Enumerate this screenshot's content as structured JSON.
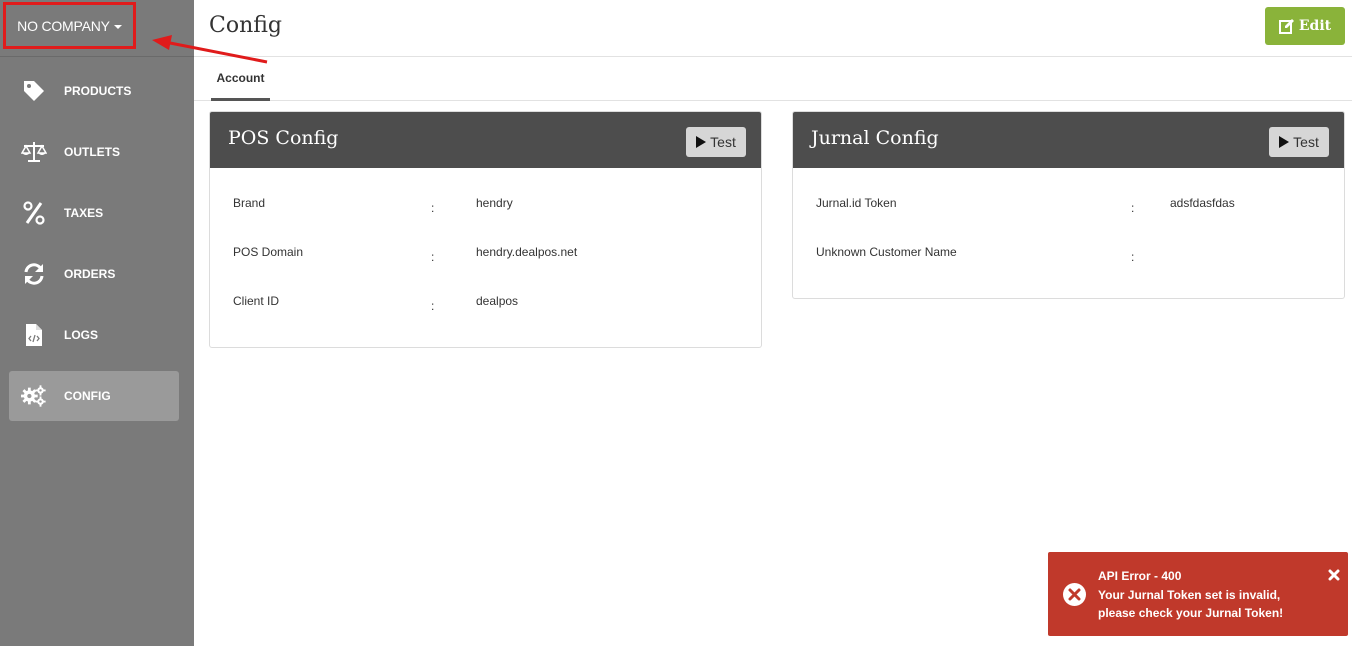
{
  "company": {
    "label": "NO COMPANY"
  },
  "sidebar": {
    "items": [
      {
        "label": "PRODUCTS",
        "icon": "tag-icon"
      },
      {
        "label": "OUTLETS",
        "icon": "scale-icon"
      },
      {
        "label": "TAXES",
        "icon": "percent-icon"
      },
      {
        "label": "ORDERS",
        "icon": "sync-icon"
      },
      {
        "label": "LOGS",
        "icon": "code-file-icon"
      },
      {
        "label": "CONFIG",
        "icon": "gears-icon",
        "active": true
      }
    ]
  },
  "header": {
    "title": "Config",
    "edit_label": "Edit"
  },
  "tabs": [
    {
      "label": "Account",
      "active": true
    }
  ],
  "pos_config": {
    "title": "POS Config",
    "test_label": "Test",
    "fields": [
      {
        "label": "Brand",
        "value": "hendry"
      },
      {
        "label": "POS Domain",
        "value": "hendry.dealpos.net"
      },
      {
        "label": "Client ID",
        "value": "dealpos"
      }
    ]
  },
  "jurnal_config": {
    "title": "Jurnal Config",
    "test_label": "Test",
    "fields": [
      {
        "label": "Jurnal.id Token",
        "value": "adsfdasfdas"
      },
      {
        "label": "Unknown Customer Name",
        "value": ""
      }
    ]
  },
  "toast": {
    "title": "API Error - 400",
    "message": "Your Jurnal Token set is invalid, please check your Jurnal Token!"
  },
  "colors": {
    "sidebar": "#7a7a7a",
    "card_header": "#4d4d4d",
    "edit_button": "#8ab33a",
    "toast": "#c0392b",
    "annotation": "#e01b1b"
  }
}
